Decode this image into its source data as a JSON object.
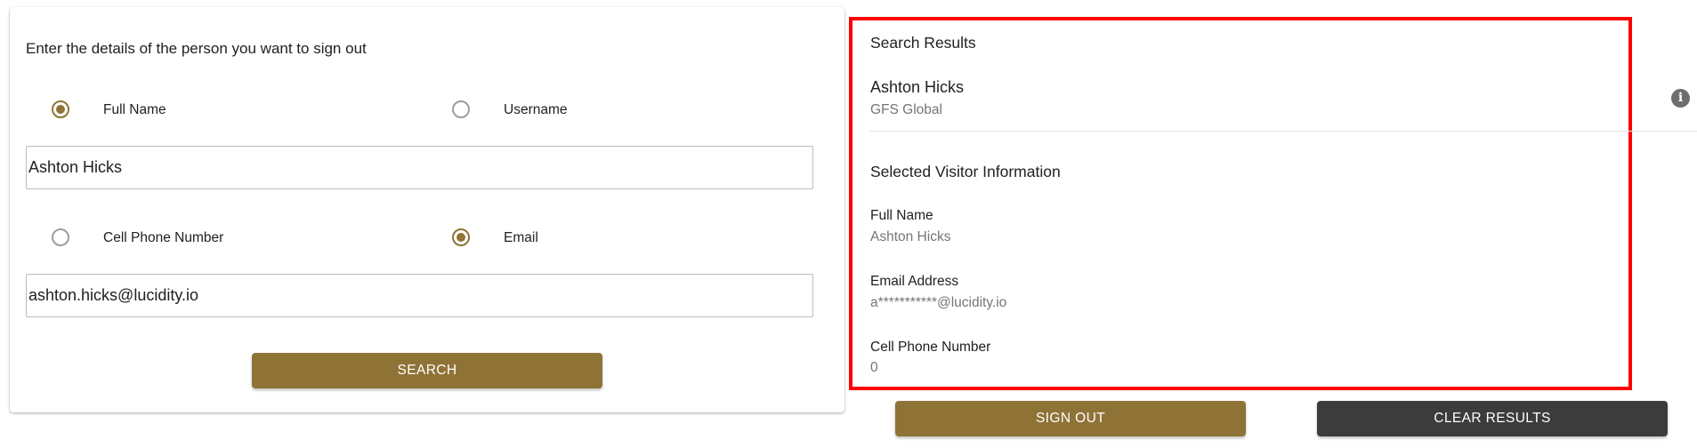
{
  "form": {
    "instruction": "Enter the details of the person you want to sign out",
    "radios_top": [
      {
        "label": "Full Name",
        "checked": true
      },
      {
        "label": "Username",
        "checked": false
      }
    ],
    "name_value": "Ashton Hicks",
    "radios_bottom": [
      {
        "label": "Cell Phone Number",
        "checked": false
      },
      {
        "label": "Email",
        "checked": true
      }
    ],
    "email_value": "ashton.hicks@lucidity.io",
    "search_label": "SEARCH"
  },
  "results": {
    "title": "Search Results",
    "item": {
      "name": "Ashton Hicks",
      "company": "GFS Global"
    },
    "info_icon": "info-icon"
  },
  "visitor": {
    "title": "Selected Visitor Information",
    "fields": [
      {
        "label": "Full Name",
        "value": "Ashton Hicks"
      },
      {
        "label": "Email Address",
        "value": "a***********@lucidity.io"
      },
      {
        "label": "Cell Phone Number",
        "value": "0"
      }
    ]
  },
  "actions": {
    "sign_out_label": "SIGN OUT",
    "clear_label": "CLEAR RESULTS"
  },
  "colors": {
    "accent": "#8f7336",
    "dark_button": "#3c3c3c",
    "highlight_border": "#ff0000"
  }
}
